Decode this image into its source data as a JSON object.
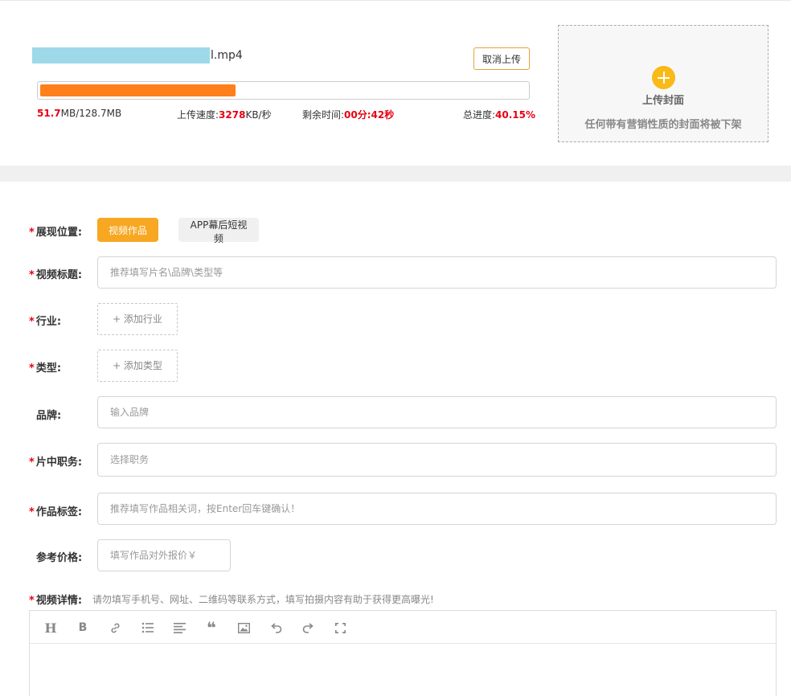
{
  "upload": {
    "file_ext": "l.mp4",
    "cancel_label": "取消上传",
    "progress_fraction": 0.4015,
    "uploaded": "51.7",
    "size_rest": "MB/128.7MB",
    "speed_label": "上传速度:",
    "speed_value": "3278",
    "speed_unit": "KB/秒",
    "remain_label": "剩余时间:",
    "remain_value": "00分:42秒",
    "total_label": "总进度:",
    "total_value": "40.15%",
    "accent_color": "#ff7f1a"
  },
  "cover": {
    "title": "上传封面",
    "note": "任何带有营销性质的封面将被下架",
    "icon": "plus-circle-icon"
  },
  "form": {
    "position_label": "展现位置:",
    "position_options": [
      "视频作品",
      "APP幕后短视频"
    ],
    "title_label": "视频标题:",
    "title_placeholder": "推荐填写片名\\品牌\\类型等",
    "industry_label": "行业:",
    "industry_add": "+ 添加行业",
    "type_label": "类型:",
    "type_add": "+ 添加类型",
    "brand_label": "品牌:",
    "brand_placeholder": "输入品牌",
    "role_label": "片中职务:",
    "role_placeholder": "选择职务",
    "tags_label": "作品标签:",
    "tags_placeholder": "推荐填写作品相关词，按Enter回车键确认！",
    "price_label": "参考价格:",
    "price_placeholder": "填写作品对外报价￥",
    "detail_label": "视频详情:",
    "detail_hint": "请勿填写手机号、网址、二维码等联系方式，填写拍摄内容有助于获得更高曝光!",
    "required_mark": "*"
  },
  "editor": {
    "toolbar": [
      "heading-icon",
      "bold-icon",
      "link-icon",
      "list-icon",
      "align-icon",
      "quote-icon",
      "image-icon",
      "undo-icon",
      "redo-icon",
      "fullscreen-icon"
    ],
    "heading_glyph": "H",
    "bold_glyph": "B",
    "quote_glyph": "❝"
  }
}
